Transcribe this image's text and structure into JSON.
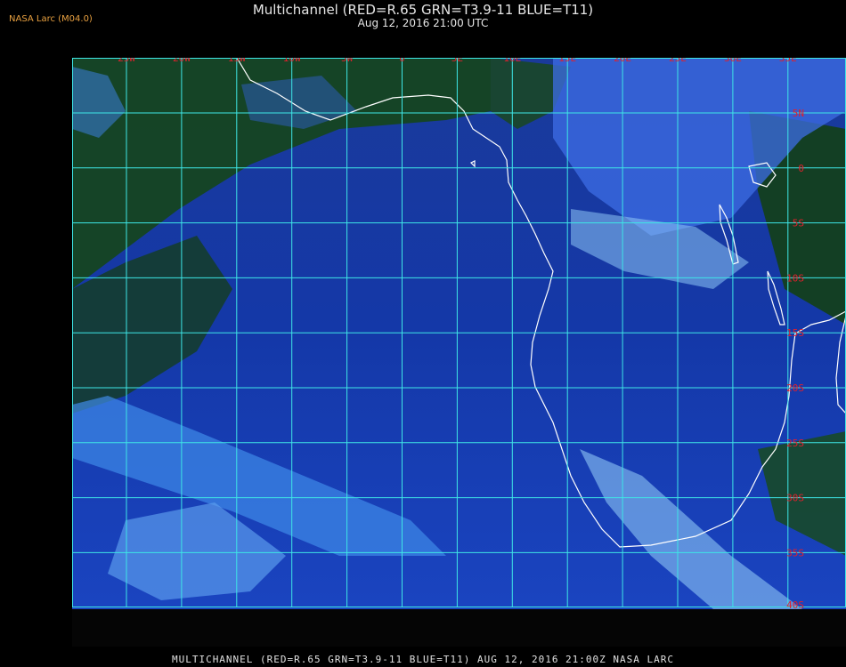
{
  "header": {
    "producer": "NASA Larc (M04.0)",
    "title": "Multichannel (RED=R.65 GRN=T3.9-11 BLUE=T11)",
    "timestamp": "Aug 12, 2016 21:00 UTC"
  },
  "footer": {
    "caption": "MULTICHANNEL (RED=R.65 GRN=T3.9-11 BLUE=T11) AUG 12, 2016 21:00Z  NASA LARC"
  },
  "map": {
    "longitude_labels": [
      "25W",
      "20W",
      "15W",
      "10W",
      "5W",
      "0",
      "5E",
      "10E",
      "15E",
      "20E",
      "25E",
      "30E",
      "35E"
    ],
    "latitude_labels": [
      "5N",
      "0",
      "5S",
      "10S",
      "15S",
      "20S",
      "25S",
      "30S",
      "35S",
      "40S"
    ],
    "colors": {
      "grid": "#3ee6e6",
      "label": "#e0202c",
      "coastline": "#ffffff",
      "land_cloudfree": "#123a12",
      "ocean": "#0f2f8a",
      "cloud": "#74b8f0"
    }
  }
}
